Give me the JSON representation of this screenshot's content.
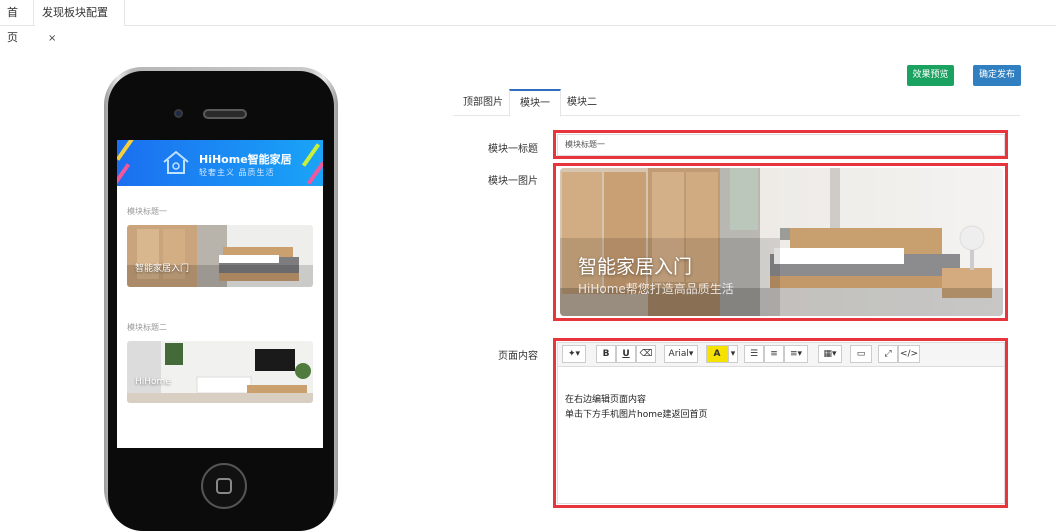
{
  "tabs_bar": {
    "home": "首页",
    "active_tab": "发现板块配置",
    "close": "×"
  },
  "phone": {
    "brand_title": "HiHome智能家居",
    "brand_sub": "轻奢主义 品质生活",
    "module1_title": "模块标题一",
    "module1_image_label": "智能家居入门",
    "module2_title": "模块标题二",
    "module2_image_label": "HiHome"
  },
  "actions": {
    "preview": "效果预览",
    "publish": "确定发布"
  },
  "content_tabs": [
    "顶部图片",
    "模块一",
    "模块二"
  ],
  "form": {
    "title_label": "模块一标题",
    "title_value": "模块标题一",
    "image_label": "模块一图片",
    "image_title": "智能家居入门",
    "image_subtitle": "HiHome帮您打造高品质生活",
    "content_label": "页面内容"
  },
  "editor": {
    "font": "Arial",
    "lines": [
      "在右边编辑页面内容",
      "单击下方手机图片home建返回首页"
    ]
  },
  "colors": {
    "highlight": "#e8343d",
    "preview_button": "#1aa260",
    "publish_button": "#2f7fc1",
    "banner_blue": "#1b6ff0"
  }
}
